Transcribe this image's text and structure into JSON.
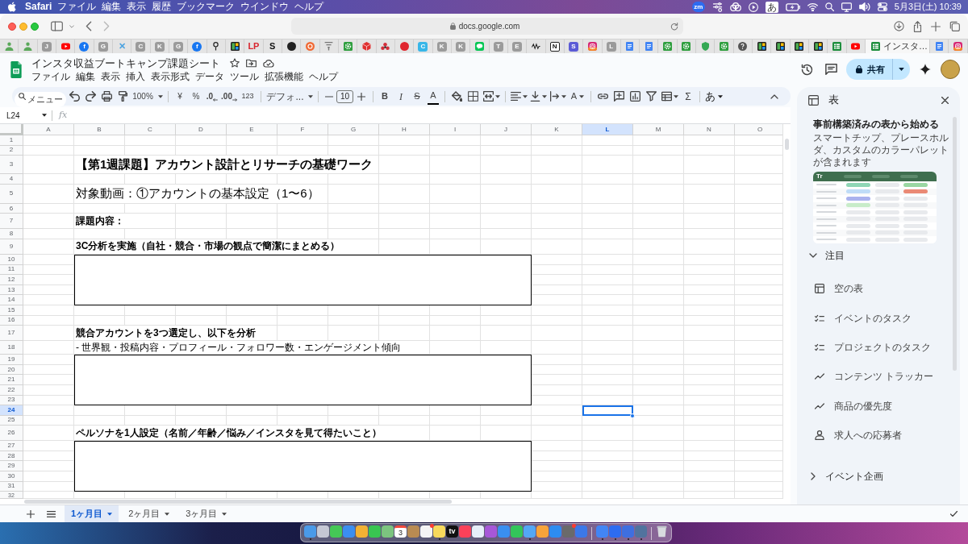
{
  "menu_bar": {
    "app": "Safari",
    "menus": [
      "ファイル",
      "編集",
      "表示",
      "履歴",
      "ブックマーク",
      "ウインドウ",
      "ヘルプ"
    ],
    "meeting_badge": "zm",
    "input_mode": "あ",
    "clock": "5月3日(土) 10:39"
  },
  "browser": {
    "address": "docs.google.com",
    "tabs": [
      {
        "kind": "person",
        "selected": false
      },
      {
        "kind": "person",
        "selected": false
      },
      {
        "kind": "letter",
        "text": "J",
        "color": "#9b9b9b",
        "selected": false
      },
      {
        "kind": "youtube",
        "selected": false
      },
      {
        "kind": "round",
        "text": "f",
        "color": "#1877f2",
        "selected": false
      },
      {
        "kind": "letter",
        "text": "G",
        "color": "#9b9b9b",
        "selected": false
      },
      {
        "kind": "wordmark",
        "text": "✕",
        "color": "#4da3e0",
        "selected": false
      },
      {
        "kind": "letter",
        "text": "C",
        "color": "#9b9b9b",
        "selected": false
      },
      {
        "kind": "letter",
        "text": "K",
        "color": "#9b9b9b",
        "selected": false
      },
      {
        "kind": "letter",
        "text": "G",
        "color": "#9b9b9b",
        "selected": false
      },
      {
        "kind": "round",
        "text": "f",
        "color": "#1877f2",
        "selected": false
      },
      {
        "kind": "pin",
        "selected": false
      },
      {
        "kind": "tiles",
        "selected": false
      },
      {
        "kind": "wordmark",
        "text": "LP",
        "color": "#d8262f",
        "selected": false
      },
      {
        "kind": "wordmark",
        "text": "S",
        "color": "#111111",
        "selected": false
      },
      {
        "kind": "dot",
        "color": "#222222",
        "selected": false
      },
      {
        "kind": "ring",
        "color": "#f06a35",
        "selected": false
      },
      {
        "kind": "lines",
        "selected": false
      },
      {
        "kind": "gear",
        "selected": false
      },
      {
        "kind": "cube",
        "selected": false
      },
      {
        "kind": "flower",
        "selected": false
      },
      {
        "kind": "dot",
        "color": "#e0262f",
        "selected": false
      },
      {
        "kind": "letter",
        "text": "C",
        "color": "#38b6e8",
        "selected": false
      },
      {
        "kind": "letter",
        "text": "K",
        "color": "#9b9b9b",
        "selected": false
      },
      {
        "kind": "letter",
        "text": "K",
        "color": "#9b9b9b",
        "selected": false
      },
      {
        "kind": "chat",
        "selected": false
      },
      {
        "kind": "letter",
        "text": "T",
        "color": "#9b9b9b",
        "selected": false
      },
      {
        "kind": "letter",
        "text": "E",
        "color": "#9b9b9b",
        "selected": false
      },
      {
        "kind": "wave",
        "selected": false
      },
      {
        "kind": "outlined",
        "text": "N",
        "selected": false
      },
      {
        "kind": "letter",
        "text": "S",
        "color": "#5b5bd6",
        "selected": false
      },
      {
        "kind": "instagram",
        "selected": false
      },
      {
        "kind": "letter",
        "text": "L",
        "color": "#9b9b9b",
        "selected": false
      },
      {
        "kind": "doc",
        "selected": false
      },
      {
        "kind": "doc",
        "selected": false
      },
      {
        "kind": "gear",
        "selected": false
      },
      {
        "kind": "gear",
        "selected": false
      },
      {
        "kind": "shield",
        "selected": false
      },
      {
        "kind": "gear",
        "selected": false
      },
      {
        "kind": "help",
        "selected": false
      },
      {
        "kind": "tiles",
        "selected": false
      },
      {
        "kind": "tiles",
        "selected": false
      },
      {
        "kind": "tiles",
        "selected": false
      },
      {
        "kind": "tiles",
        "selected": false
      },
      {
        "kind": "sheet",
        "selected": false
      },
      {
        "kind": "youtube",
        "selected": false
      },
      {
        "kind": "sheet",
        "title": "インスタ…",
        "selected": true
      },
      {
        "kind": "doc",
        "selected": false
      },
      {
        "kind": "instagram",
        "selected": false
      }
    ]
  },
  "document": {
    "title": "インスタ収益ブートキャンプ課題シート",
    "menus": [
      "ファイル",
      "編集",
      "表示",
      "挿入",
      "表示形式",
      "データ",
      "ツール",
      "拡張機能",
      "ヘルプ"
    ],
    "share": "共有"
  },
  "toolbar": {
    "search_placeholder": "メニュー",
    "zoom": "100%",
    "currency": "¥",
    "percent": "%",
    "decrease_decimal": ".0",
    "increase_decimal": ".00",
    "number_format": "123",
    "font": "デフォ...",
    "font_size": "10",
    "bold": "B",
    "italic": "I",
    "strikethrough": "S",
    "text_color": "A",
    "text_rotation": "A",
    "functions": "Σ",
    "input_tools": "あ"
  },
  "sheet": {
    "name_box": "L24",
    "formula_prefix": "fx",
    "columns": [
      {
        "label": "A",
        "selected": false
      },
      {
        "label": "B",
        "selected": false
      },
      {
        "label": "C",
        "selected": false
      },
      {
        "label": "D",
        "selected": false
      },
      {
        "label": "E",
        "selected": false
      },
      {
        "label": "F",
        "selected": false
      },
      {
        "label": "G",
        "selected": false
      },
      {
        "label": "H",
        "selected": false
      },
      {
        "label": "I",
        "selected": false
      },
      {
        "label": "J",
        "selected": false
      },
      {
        "label": "K",
        "selected": false
      },
      {
        "label": "L",
        "selected": true
      },
      {
        "label": "M",
        "selected": false
      },
      {
        "label": "N",
        "selected": false
      },
      {
        "label": "O",
        "selected": false
      }
    ],
    "rows": [
      {
        "number": "1",
        "selected": false,
        "boxed": false
      },
      {
        "number": "2",
        "selected": false,
        "boxed": false
      },
      {
        "number": "3",
        "selected": false,
        "boxed": false,
        "kind": "title",
        "text": "【第1週課題】アカウント設計とリサーチの基礎ワーク"
      },
      {
        "number": "4",
        "selected": false,
        "boxed": false
      },
      {
        "number": "5",
        "selected": false,
        "boxed": false,
        "kind": "subtitle",
        "text": "対象動画：①アカウントの基本設定（1〜6）"
      },
      {
        "number": "6",
        "selected": false,
        "boxed": false
      },
      {
        "number": "7",
        "selected": false,
        "boxed": false,
        "kind": "heading",
        "text": "課題内容："
      },
      {
        "number": "8",
        "selected": false,
        "boxed": false
      },
      {
        "number": "9",
        "selected": false,
        "boxed": false,
        "kind": "heading",
        "text": "3C分析を実施（自社・競合・市場の観点で簡潔にまとめる）"
      },
      {
        "number": "10",
        "selected": false,
        "boxed": true
      },
      {
        "number": "11",
        "selected": false,
        "boxed": true
      },
      {
        "number": "12",
        "selected": false,
        "boxed": true
      },
      {
        "number": "13",
        "selected": false,
        "boxed": true
      },
      {
        "number": "14",
        "selected": false,
        "boxed": true
      },
      {
        "number": "15",
        "selected": false,
        "boxed": false
      },
      {
        "number": "16",
        "selected": false,
        "boxed": false
      },
      {
        "number": "17",
        "selected": false,
        "boxed": false,
        "kind": "heading",
        "text": "競合アカウントを3つ選定し、以下を分析"
      },
      {
        "number": "18",
        "selected": false,
        "boxed": false,
        "kind": "body",
        "text": "- 世界観・投稿内容・プロフィール・フォロワー数・エンゲージメント傾向"
      },
      {
        "number": "19",
        "selected": false,
        "boxed": true
      },
      {
        "number": "20",
        "selected": false,
        "boxed": true
      },
      {
        "number": "21",
        "selected": false,
        "boxed": true
      },
      {
        "number": "22",
        "selected": false,
        "boxed": true
      },
      {
        "number": "23",
        "selected": false,
        "boxed": true
      },
      {
        "number": "24",
        "selected": true,
        "boxed": false
      },
      {
        "number": "25",
        "selected": false,
        "boxed": false
      },
      {
        "number": "26",
        "selected": false,
        "boxed": false,
        "kind": "heading",
        "text": "ペルソナを1人設定（名前／年齢／悩み／インスタを見て得たいこと）"
      },
      {
        "number": "27",
        "selected": false,
        "boxed": true
      },
      {
        "number": "28",
        "selected": false,
        "boxed": true
      },
      {
        "number": "29",
        "selected": false,
        "boxed": true
      },
      {
        "number": "30",
        "selected": false,
        "boxed": true
      },
      {
        "number": "31",
        "selected": false,
        "boxed": true
      },
      {
        "number": "32",
        "selected": false,
        "boxed": false
      }
    ]
  },
  "sheet_tabs": [
    {
      "label": "1ヶ月目",
      "selected": true
    },
    {
      "label": "2ヶ月目",
      "selected": false
    },
    {
      "label": "3ヶ月目",
      "selected": false
    }
  ],
  "side_panel": {
    "title": "表",
    "heading": "事前構築済みの表から始める",
    "description": "スマートチップ、プレースホルダ、カスタムのカラーパレットが含まれます",
    "preview_label": "Tr",
    "sections": [
      {
        "title": "注目",
        "expanded": true,
        "items": [
          {
            "kind": "table",
            "label": "空の表"
          },
          {
            "kind": "checklist",
            "label": "イベントのタスク"
          },
          {
            "kind": "checklist",
            "label": "プロジェクトのタスク"
          },
          {
            "kind": "trend",
            "label": "コンテンツ トラッカー"
          },
          {
            "kind": "trend",
            "label": "商品の優先度"
          },
          {
            "kind": "person",
            "label": "求人への応募者"
          }
        ]
      },
      {
        "title": "イベント企画",
        "expanded": false
      }
    ]
  },
  "dock": [
    {
      "kind": "app",
      "color": "#4a9ae8",
      "running": true,
      "badge": false
    },
    {
      "kind": "app",
      "color": "#c5c8d4",
      "running": false,
      "badge": false
    },
    {
      "kind": "app",
      "color": "#45c856",
      "running": false,
      "badge": false
    },
    {
      "kind": "app",
      "color": "#3b8ef0",
      "running": false,
      "badge": false
    },
    {
      "kind": "app",
      "color": "#f2b134",
      "running": false,
      "badge": false
    },
    {
      "kind": "app",
      "color": "#39c551",
      "running": false,
      "badge": false
    },
    {
      "kind": "app",
      "color": "#7cc47f",
      "running": false,
      "badge": false
    },
    {
      "kind": "calendar",
      "text": "3",
      "running": false,
      "badge": false
    },
    {
      "kind": "app",
      "color": "#b98b52",
      "running": false,
      "badge": false
    },
    {
      "kind": "app",
      "color": "#f4f4f4",
      "running": false,
      "badge": true
    },
    {
      "kind": "app",
      "color": "#f7d95c",
      "running": true,
      "badge": false
    },
    {
      "kind": "tv",
      "text": "tv",
      "running": false,
      "badge": false
    },
    {
      "kind": "app",
      "color": "#fb4159",
      "running": false,
      "badge": false
    },
    {
      "kind": "app",
      "color": "#e6eef9",
      "running": false,
      "badge": false
    },
    {
      "kind": "app",
      "color": "#a757d8",
      "running": false,
      "badge": false
    },
    {
      "kind": "app",
      "color": "#3a8ff0",
      "running": false,
      "badge": false
    },
    {
      "kind": "app",
      "color": "#33c55a",
      "running": false,
      "badge": false
    },
    {
      "kind": "app",
      "color": "#53a7f5",
      "running": true,
      "badge": false
    },
    {
      "kind": "app",
      "color": "#f7a33a",
      "running": false,
      "badge": false
    },
    {
      "kind": "app",
      "color": "#2d8cf0",
      "running": false,
      "badge": false
    },
    {
      "kind": "app",
      "color": "#6a6a6a",
      "running": false,
      "badge": true
    },
    {
      "kind": "app",
      "color": "#3c78e8",
      "running": false,
      "badge": false
    },
    {
      "kind": "separator"
    },
    {
      "kind": "app",
      "color": "#4285f4",
      "running": true,
      "badge": false
    },
    {
      "kind": "app",
      "color": "#2d6cf1",
      "running": true,
      "badge": false
    },
    {
      "kind": "app",
      "color": "#3f6fe0",
      "running": true,
      "badge": false
    },
    {
      "kind": "app",
      "color": "#51739e",
      "running": true,
      "badge": false
    },
    {
      "kind": "separator"
    },
    {
      "kind": "trash",
      "running": false,
      "badge": false
    }
  ]
}
